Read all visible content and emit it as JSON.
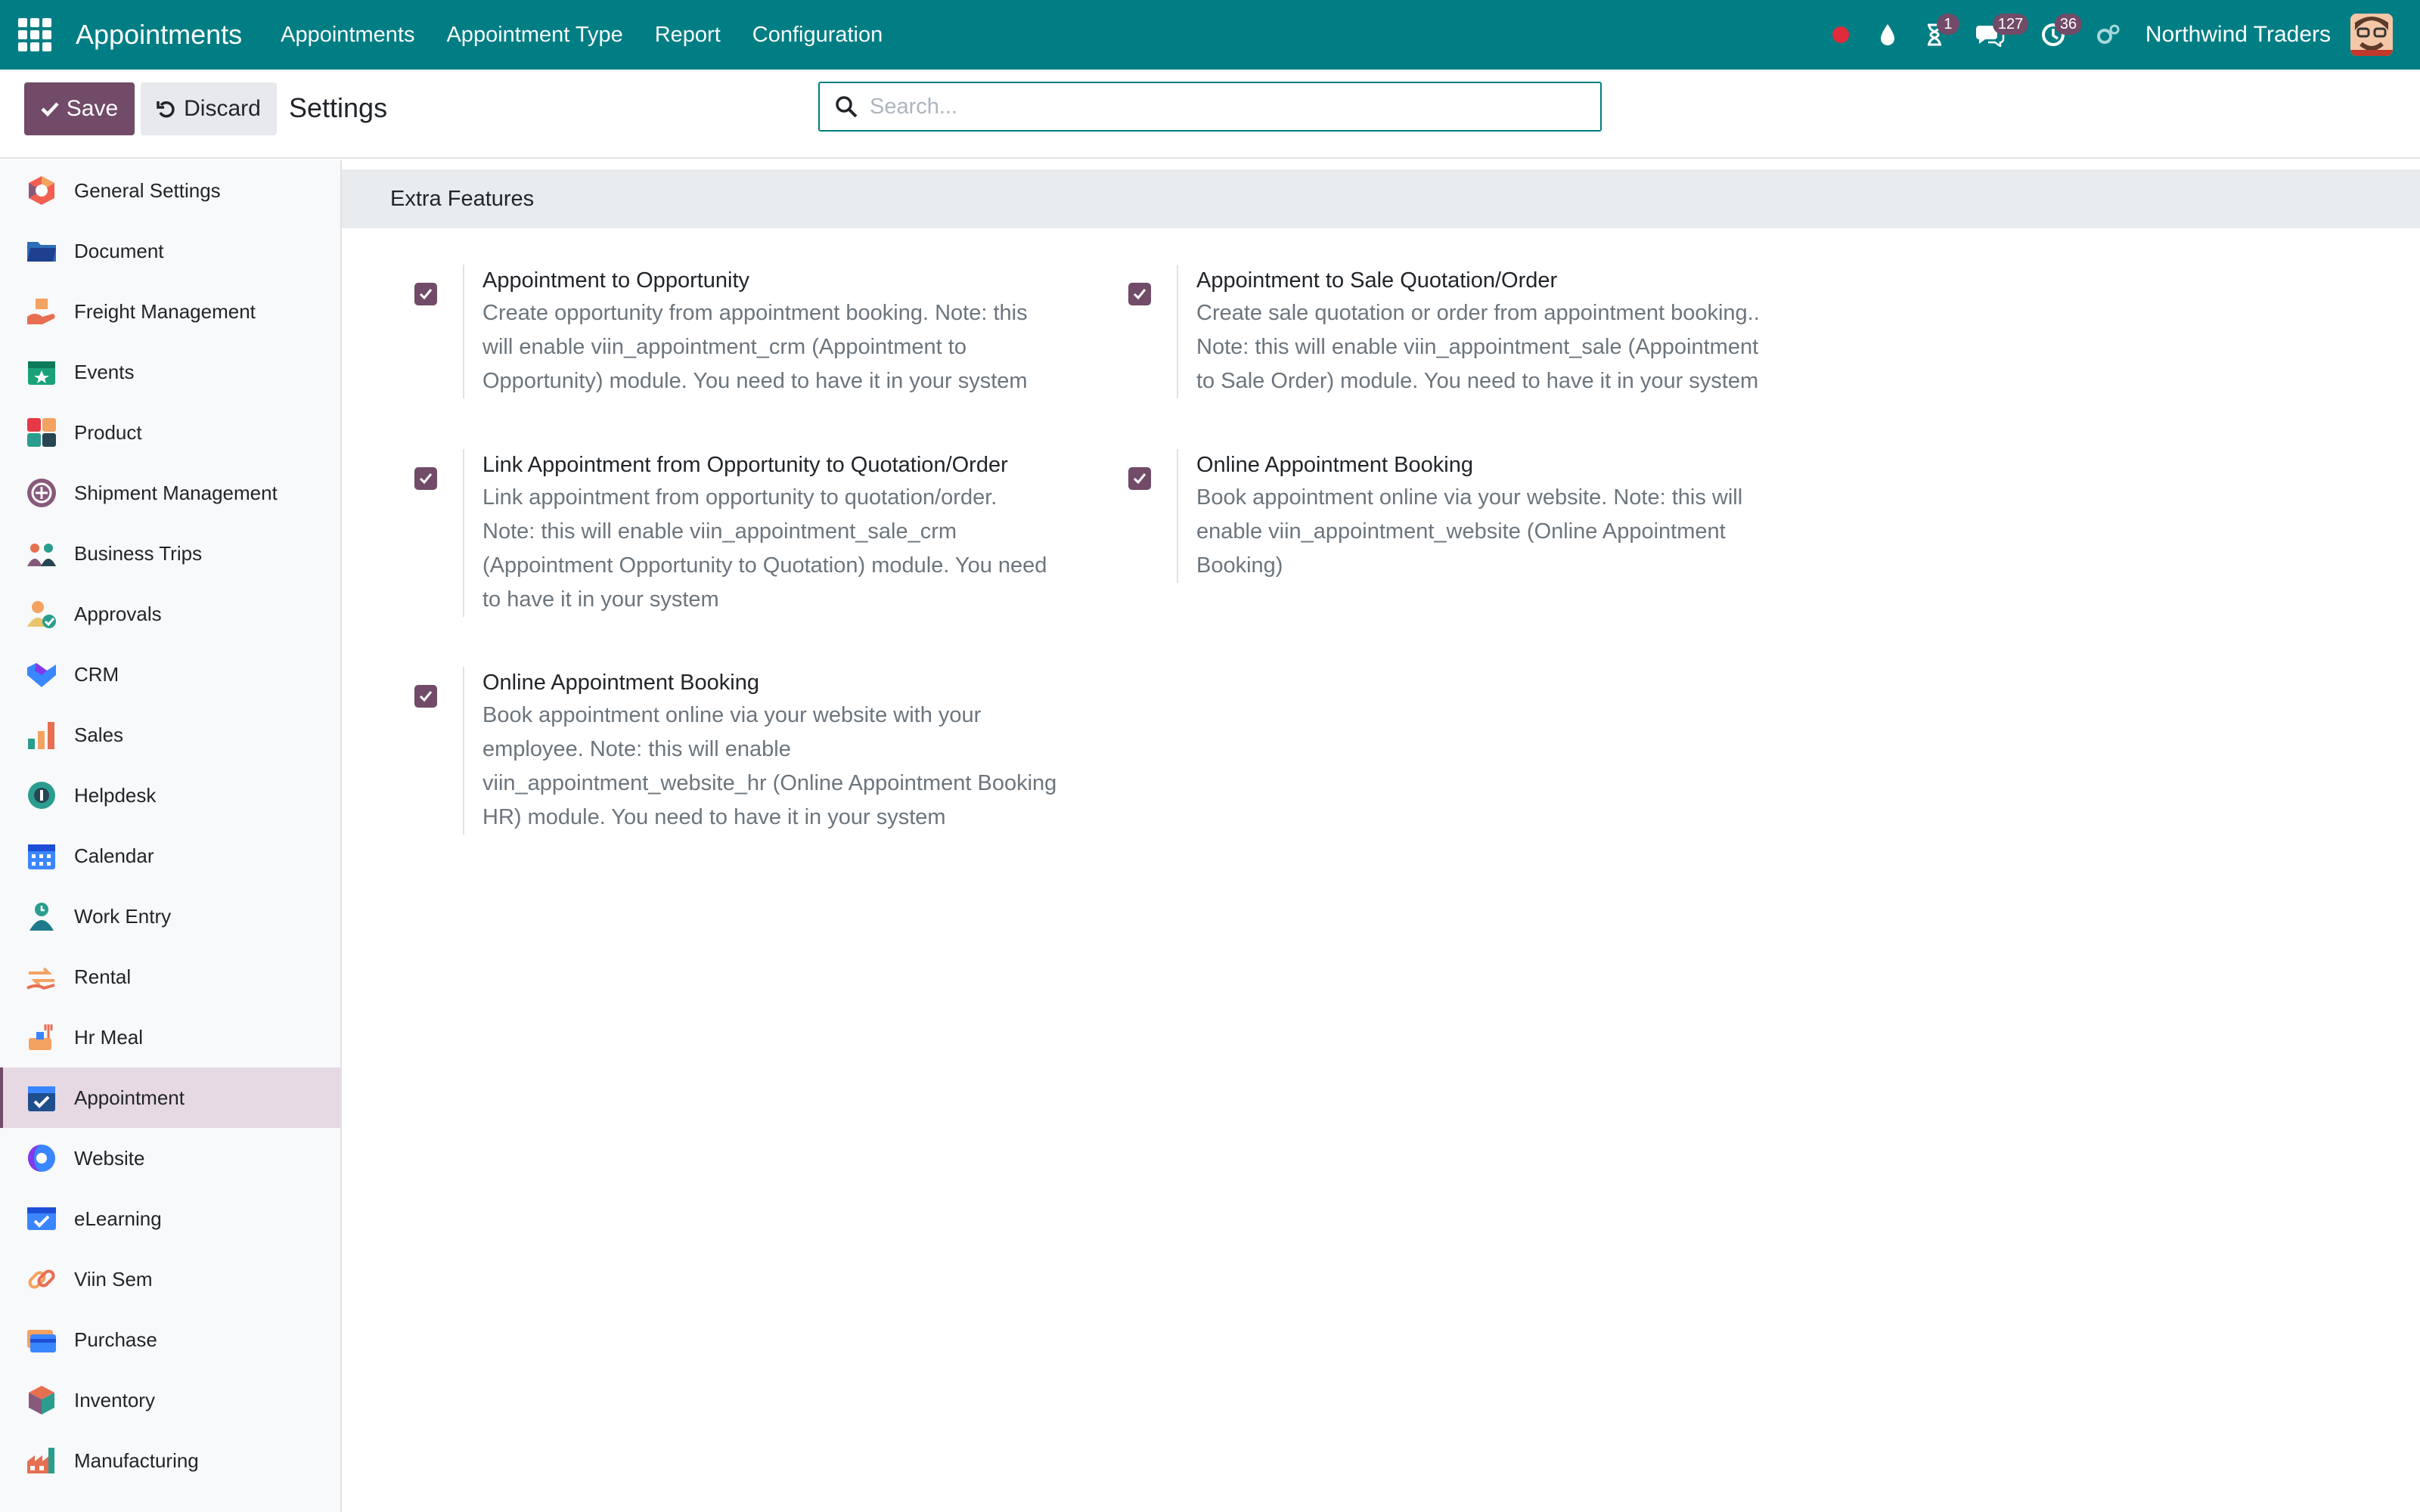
{
  "navbar": {
    "app_name": "Appointments",
    "menu": [
      "Appointments",
      "Appointment Type",
      "Report",
      "Configuration"
    ],
    "badges": {
      "activities": "1",
      "messages": "127",
      "timesheets": "36"
    },
    "company": "Northwind Traders"
  },
  "control": {
    "save_label": "Save",
    "discard_label": "Discard",
    "title": "Settings",
    "search_placeholder": "Search..."
  },
  "sidebar": {
    "items": [
      {
        "label": "General Settings",
        "icon": "general-settings-icon"
      },
      {
        "label": "Document",
        "icon": "folder-icon"
      },
      {
        "label": "Freight Management",
        "icon": "freight-icon"
      },
      {
        "label": "Events",
        "icon": "events-icon"
      },
      {
        "label": "Product",
        "icon": "product-icon"
      },
      {
        "label": "Shipment Management",
        "icon": "shipment-icon"
      },
      {
        "label": "Business Trips",
        "icon": "business-trips-icon"
      },
      {
        "label": "Approvals",
        "icon": "approvals-icon"
      },
      {
        "label": "CRM",
        "icon": "crm-icon"
      },
      {
        "label": "Sales",
        "icon": "sales-icon"
      },
      {
        "label": "Helpdesk",
        "icon": "helpdesk-icon"
      },
      {
        "label": "Calendar",
        "icon": "calendar-icon"
      },
      {
        "label": "Work Entry",
        "icon": "work-entry-icon"
      },
      {
        "label": "Rental",
        "icon": "rental-icon"
      },
      {
        "label": "Hr Meal",
        "icon": "hr-meal-icon"
      },
      {
        "label": "Appointment",
        "icon": "appointment-icon",
        "active": true
      },
      {
        "label": "Website",
        "icon": "website-icon"
      },
      {
        "label": "eLearning",
        "icon": "elearning-icon"
      },
      {
        "label": "Viin Sem",
        "icon": "viin-sem-icon"
      },
      {
        "label": "Purchase",
        "icon": "purchase-icon"
      },
      {
        "label": "Inventory",
        "icon": "inventory-icon"
      },
      {
        "label": "Manufacturing",
        "icon": "manufacturing-icon"
      }
    ]
  },
  "main": {
    "section_title": "Extra Features",
    "settings": [
      {
        "label": "Appointment to Opportunity",
        "checked": true,
        "desc_lines": [
          "Create opportunity from appointment booking. Note: this",
          "will enable viin_appointment_crm (Appointment to",
          "Opportunity) module. You need to have it in your system"
        ]
      },
      {
        "label": "Appointment to Sale Quotation/Order",
        "checked": true,
        "desc_lines": [
          "Create sale quotation or order from appointment booking..",
          "Note: this will enable viin_appointment_sale (Appointment",
          "to Sale Order) module. You need to have it in your system"
        ]
      },
      {
        "label": "Link Appointment from Opportunity to Quotation/Order",
        "checked": true,
        "desc_lines": [
          "Link appointment from opportunity to quotation/order.",
          "Note: this will enable viin_appointment_sale_crm",
          "(Appointment Opportunity to Quotation) module. You need",
          "to have it in your system"
        ]
      },
      {
        "label": "Online Appointment Booking",
        "checked": true,
        "desc_lines": [
          "Book appointment online via your website. Note: this will",
          "enable viin_appointment_website (Online Appointment",
          "Booking)"
        ]
      },
      {
        "label": "Online Appointment Booking",
        "checked": true,
        "desc_lines": [
          "Book appointment online via your website with your",
          "employee. Note: this will enable",
          "viin_appointment_website_hr (Online Appointment Booking",
          "HR) module. You need to have it in your system"
        ]
      }
    ]
  },
  "colors": {
    "navbar": "#017e84",
    "primary": "#714b67",
    "active_sidebar": "#e6d9e3",
    "section_header": "#e9ecef"
  }
}
